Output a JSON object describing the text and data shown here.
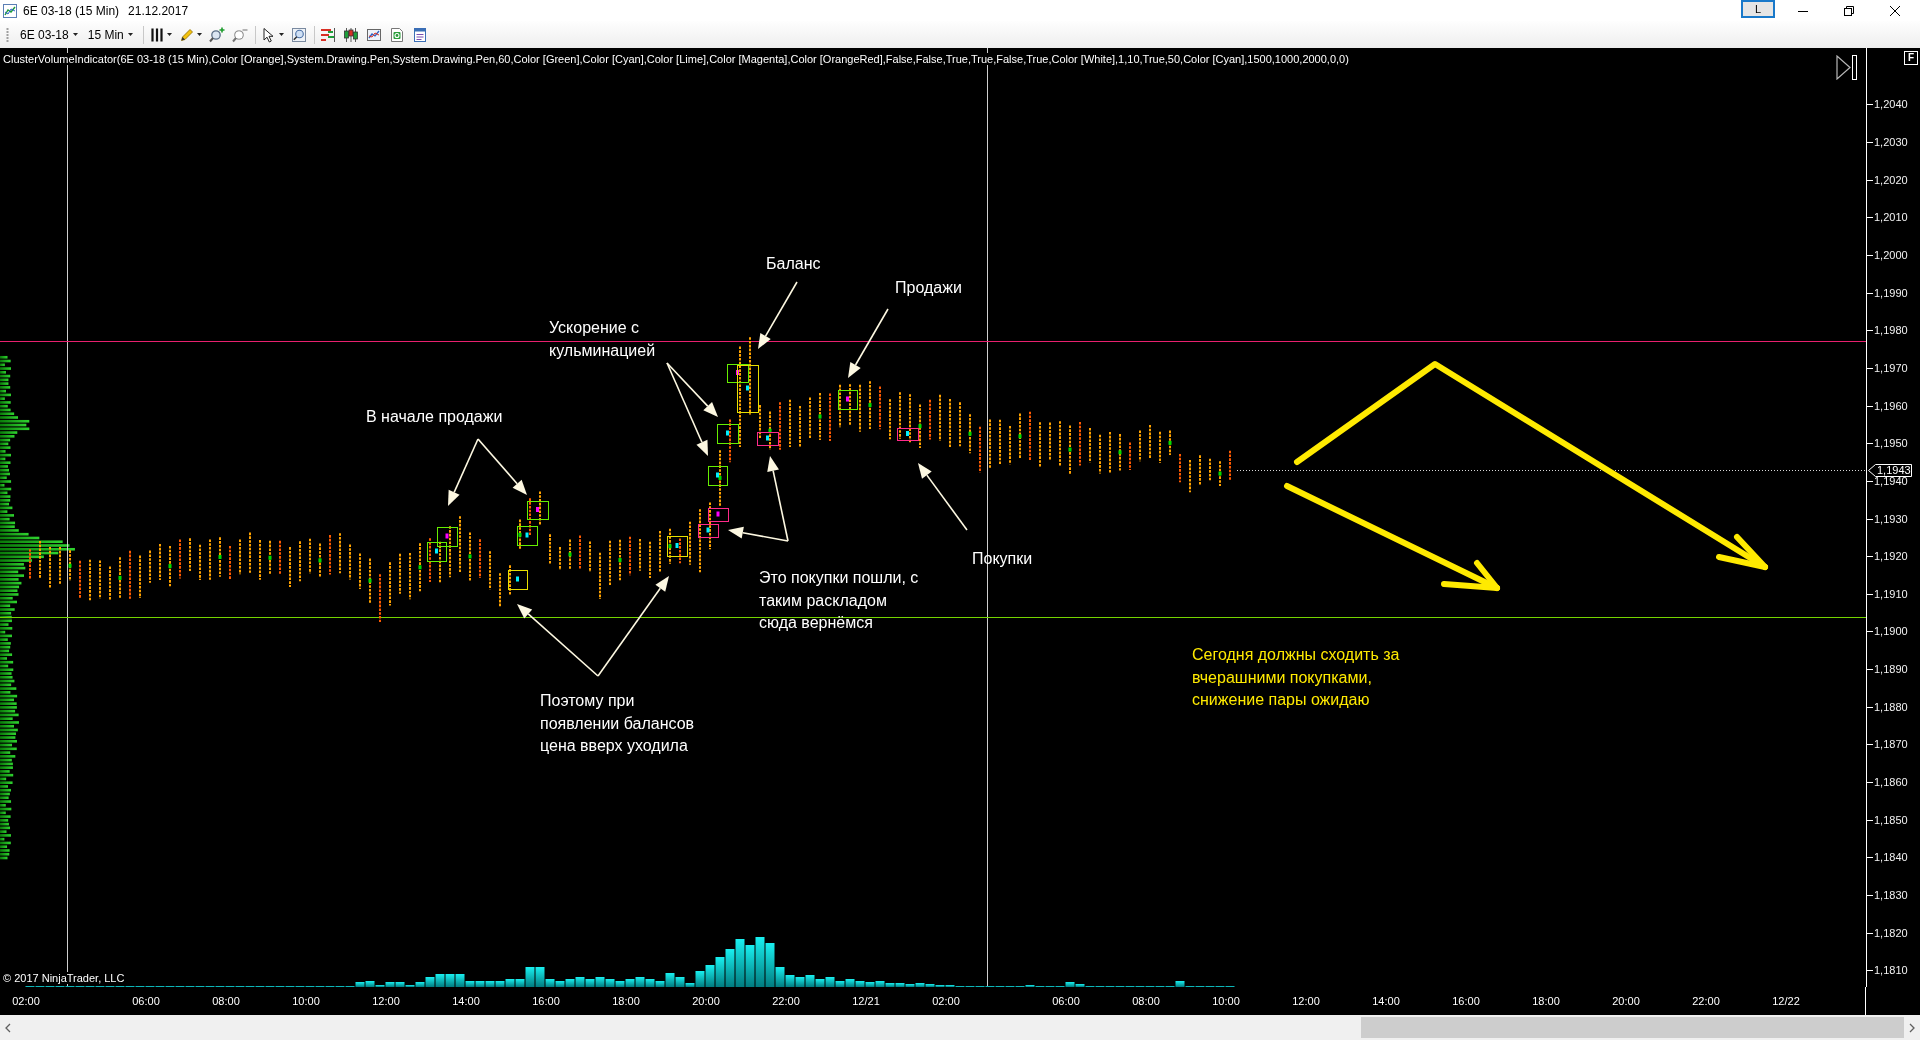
{
  "window": {
    "title": "6E 03-18 (15 Min)",
    "date": "21.12.2017",
    "caption_button": "L"
  },
  "toolbar": {
    "instrument": "6E 03-18",
    "period": "15 Min",
    "tools": [
      {
        "disabled": false
      },
      {
        "disabled": false
      },
      {
        "disabled": false
      },
      {
        "disabled": true
      },
      {
        "disabled": false
      },
      {
        "disabled": false
      },
      {
        "disabled": false
      },
      {
        "disabled": false
      },
      {
        "disabled": false
      },
      {
        "disabled": false
      },
      {
        "disabled": false
      }
    ]
  },
  "chart": {
    "indicator_label": "ClusterVolumeIndicator(6E 03-18 (15 Min),Color [Orange],System.Drawing.Pen,System.Drawing.Pen,60,Color [Green],Color [Cyan],Color [Lime],Color [Magenta],Color [OrangeRed],False,False,True,True,False,True,Color [White],1,10,True,50,Color [Cyan],1500,1000,2000,0,0)",
    "panel_button": "F",
    "annotations": [
      {
        "lines": [
          "Баланс"
        ],
        "color": "#ffffff"
      },
      {
        "lines": [
          "Продажи"
        ],
        "color": "#ffffff"
      },
      {
        "lines": [
          "Ускорение с",
          "кульминацией"
        ],
        "color": "#ffffff"
      },
      {
        "lines": [
          "В начале продажи"
        ],
        "color": "#ffffff"
      },
      {
        "lines": [
          "Покупки"
        ],
        "color": "#ffffff"
      },
      {
        "lines": [
          "Это покупки пошли, с",
          "таким раскладом",
          "сюда вернёмся"
        ],
        "color": "#ffffff"
      },
      {
        "lines": [
          "Сегодня должны сходить за",
          "вчерашними покупками,",
          "снижение пары ожидаю"
        ],
        "color": "#ffea00"
      },
      {
        "lines": [
          "Поэтому при",
          "появлении балансов",
          "цена вверх уходила"
        ],
        "color": "#ffffff"
      }
    ],
    "copyright": "© 2017 NinjaTrader, LLC",
    "price_axis": {
      "labels": [
        "1,2040",
        "1,2030",
        "1,2020",
        "1,2010",
        "1,2000",
        "1,1990",
        "1,1980",
        "1,1970",
        "1,1960",
        "1,1950",
        "1,1940",
        "1,1930",
        "1,1920",
        "1,1910",
        "1,1900",
        "1,1890",
        "1,1880",
        "1,1870",
        "1,1860",
        "1,1850",
        "1,1840",
        "1,1830",
        "1,1820",
        "1,1810"
      ],
      "last_price": "1,1943"
    },
    "time_axis": {
      "labels": [
        "02:00",
        "06:00",
        "08:00",
        "10:00",
        "12:00",
        "14:00",
        "16:00",
        "18:00",
        "20:00",
        "22:00",
        "12/21",
        "02:00",
        "06:00",
        "08:00",
        "10:00",
        "12:00",
        "14:00",
        "16:00",
        "18:00",
        "20:00",
        "22:00",
        "12/22"
      ]
    }
  }
}
